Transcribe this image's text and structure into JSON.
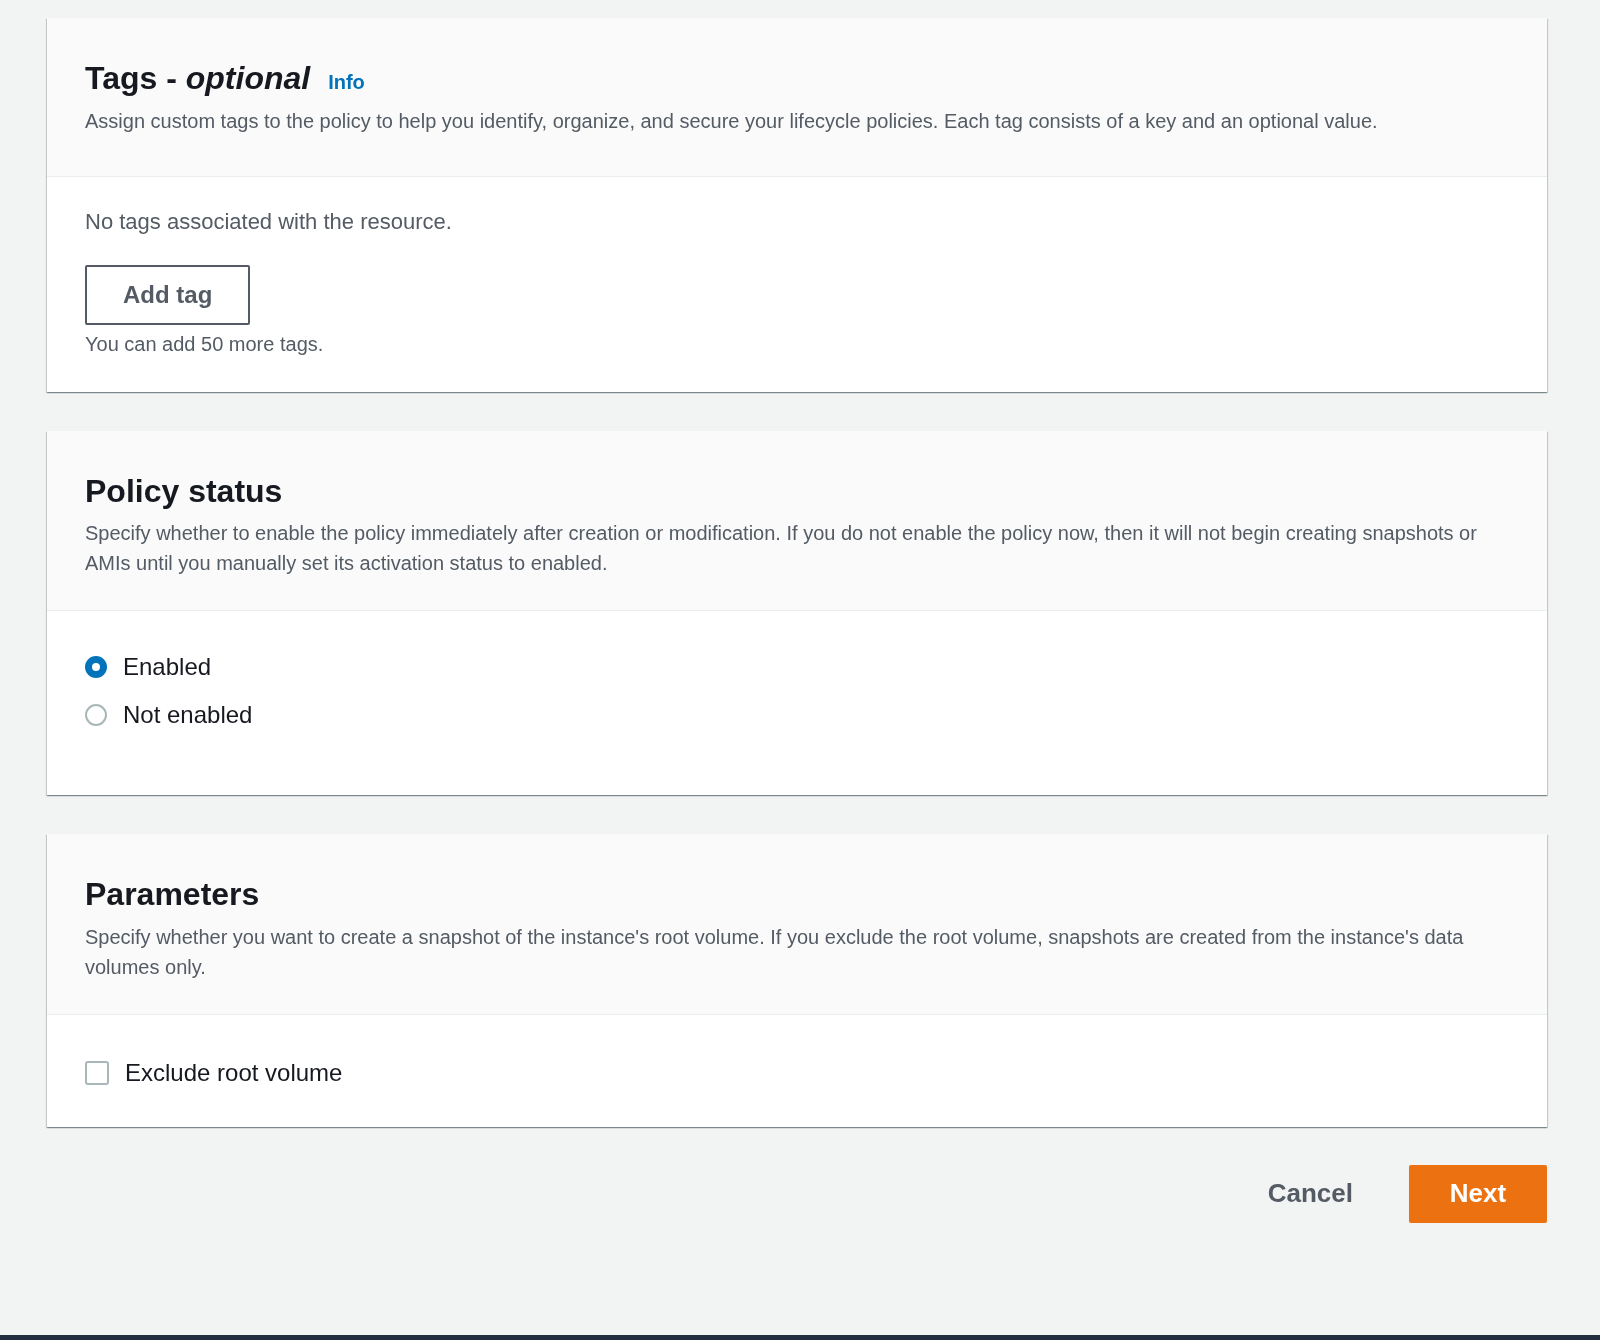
{
  "tags_section": {
    "title": "Tags - *optional*",
    "info_link": "Info",
    "description": "Assign custom tags to the policy to help you identify, organize, and secure your lifecycle policies. Each tag consists of a key and an optional value.",
    "empty_message": "No tags associated with the resource.",
    "add_button": "Add tag",
    "hint": "You can add 50 more tags."
  },
  "policy_status": {
    "title": "Policy status",
    "description": "Specify whether to enable the policy immediately after creation or modification. If you do not enable the policy now, then it will not begin creating snapshots or AMIs until you manually set its activation status to enabled.",
    "options": [
      {
        "label": "Enabled",
        "selected": true
      },
      {
        "label": "Not enabled",
        "selected": false
      }
    ]
  },
  "parameters": {
    "title": "Parameters",
    "description": "Specify whether you want to create a snapshot of the instance's root volume. If you exclude the root volume, snapshots are created from the instance's data volumes only.",
    "checkbox": {
      "label": "Exclude root volume",
      "checked": false
    }
  },
  "buttons": {
    "cancel": "Cancel",
    "next": "Next"
  }
}
